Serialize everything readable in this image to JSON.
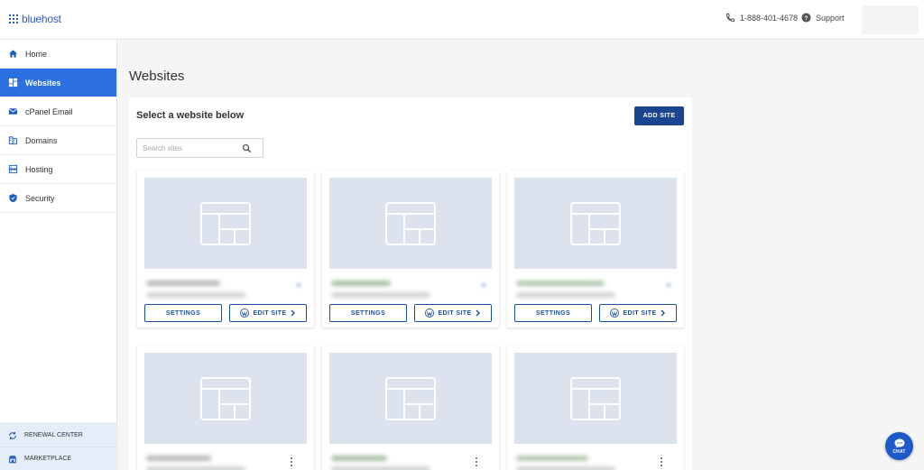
{
  "header": {
    "logo_text": "bluehost",
    "phone": "1-888-401-4678",
    "support_label": "Support"
  },
  "sidebar": {
    "items": [
      {
        "label": "Home",
        "icon": "home-icon"
      },
      {
        "label": "Websites",
        "icon": "websites-icon",
        "active": true
      },
      {
        "label": "cPanel Email",
        "icon": "email-icon"
      },
      {
        "label": "Domains",
        "icon": "domains-icon"
      },
      {
        "label": "Hosting",
        "icon": "hosting-icon"
      },
      {
        "label": "Security",
        "icon": "shield-icon"
      }
    ],
    "bottom": [
      {
        "label": "RENEWAL CENTER",
        "icon": "renewal-icon"
      },
      {
        "label": "MARKETPLACE",
        "icon": "marketplace-icon"
      }
    ]
  },
  "main": {
    "title": "Websites",
    "heading": "Select a website below",
    "add_site_label": "ADD SITE",
    "search_placeholder": "Search sites",
    "cards": {
      "settings_label": "SETTINGS",
      "edit_label": "EDIT SITE"
    }
  },
  "chat": {
    "label": "CHAT"
  },
  "colors": {
    "brand": "#2b57c4",
    "active_nav": "#2c6fe0",
    "primary_button": "#19468f",
    "outline_button": "#1a4f9c",
    "thumbnail": "#dde3ee",
    "chat": "#1d59c8"
  }
}
